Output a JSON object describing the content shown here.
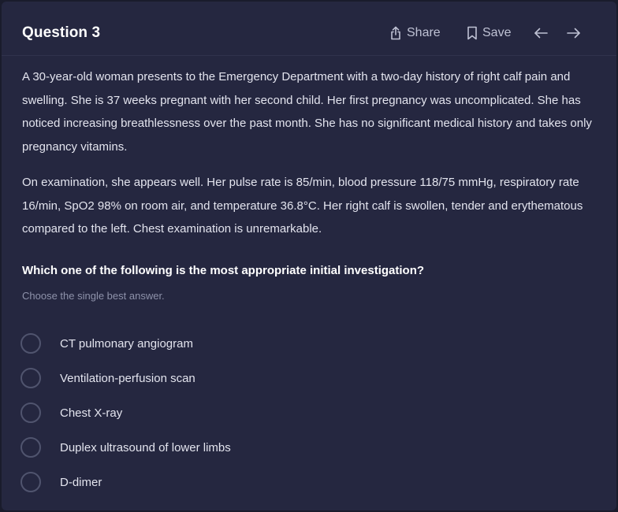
{
  "header": {
    "title": "Question 3",
    "share_label": "Share",
    "save_label": "Save",
    "icons": {
      "share": "share-icon",
      "save": "bookmark-icon",
      "prev": "arrow-left-icon",
      "next": "arrow-right-icon"
    }
  },
  "question": {
    "stem_paragraph_1": "A 30-year-old woman presents to the Emergency Department with a two-day history of right calf pain and swelling. She is 37 weeks pregnant with her second child. Her first pregnancy was uncomplicated. She has noticed increasing breathlessness over the past month. She has no significant medical history and takes only pregnancy vitamins.",
    "stem_paragraph_2": "On examination, she appears well. Her pulse rate is 85/min, blood pressure 118/75 mmHg, respiratory rate 16/min, SpO2 98% on room air, and temperature 36.8°C. Her right calf is swollen, tender and erythematous compared to the left. Chest examination is unremarkable.",
    "prompt": "Which one of the following is the most appropriate initial investigation?",
    "hint": "Choose the single best answer."
  },
  "options": [
    {
      "label": "CT pulmonary angiogram",
      "selected": false
    },
    {
      "label": "Ventilation-perfusion scan",
      "selected": false
    },
    {
      "label": "Chest X-ray",
      "selected": false
    },
    {
      "label": "Duplex ultrasound of lower limbs",
      "selected": false
    },
    {
      "label": "D-dimer",
      "selected": false
    }
  ],
  "colors": {
    "background": "#1a1c2c",
    "card": "#252740",
    "text": "#e3e4ee",
    "muted": "#8e92aa",
    "radio_border": "#50546e"
  }
}
